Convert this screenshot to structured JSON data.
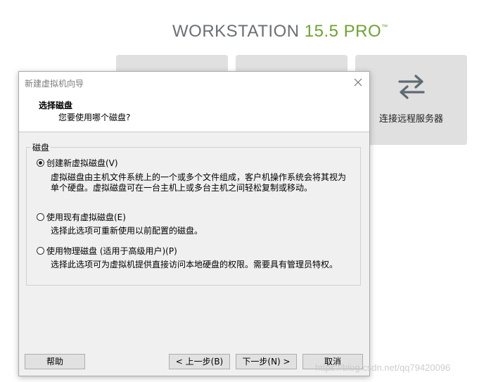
{
  "app": {
    "brand_name": "WORKSTATION",
    "brand_version": "15.5",
    "brand_edition": "PRO",
    "brand_tm": "™",
    "tiles": [
      {
        "label": ""
      },
      {
        "label": ""
      },
      {
        "label": "连接远程服务器"
      }
    ]
  },
  "dialog": {
    "title": "新建虚拟机向导",
    "header_title": "选择磁盘",
    "header_subtitle": "您要使用哪个磁盘?",
    "group_label": "磁盘",
    "options": [
      {
        "label": "创建新虚拟磁盘(V)",
        "checked": true,
        "desc_lines": [
          "虚拟磁盘由主机文件系统上的一个或多个文件组成，客户机操作系统会将其视为",
          "单个硬盘。虚拟磁盘可在一台主机上或多台主机之间轻松复制或移动。"
        ]
      },
      {
        "label": "使用现有虚拟磁盘(E)",
        "checked": false,
        "desc_lines": [
          "选择此选项可重新使用以前配置的磁盘。"
        ]
      },
      {
        "label": "使用物理磁盘 (适用于高级用户)(P)",
        "checked": false,
        "desc_lines": [
          "选择此选项可为虚拟机提供直接访问本地硬盘的权限。需要具有管理员特权。"
        ]
      }
    ],
    "buttons": {
      "help": "帮助",
      "back": "< 上一步(B)",
      "next": "下一步(N) >",
      "cancel": "取消"
    }
  },
  "watermark": "https://blog.csdn.net/qq79420096",
  "colors": {
    "brand_gray": "#6b6f73",
    "brand_green": "#6fa233",
    "tile_bg": "#e0e0e0",
    "dialog_bg": "#f0f0f0"
  }
}
